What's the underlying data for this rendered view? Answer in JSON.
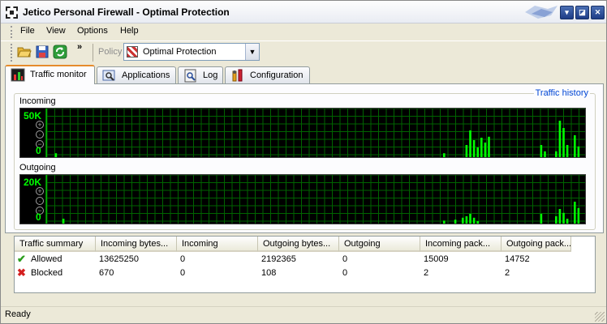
{
  "window": {
    "title": "Jetico Personal Firewall - Optimal Protection"
  },
  "menu": {
    "items": [
      "File",
      "View",
      "Options",
      "Help"
    ]
  },
  "toolbar": {
    "buttons": [
      "open-folder-icon",
      "save-disk-icon",
      "refresh-icon"
    ],
    "overflow": "»",
    "policy_label": "Policy",
    "policy_value": "Optimal Protection"
  },
  "tabs": [
    {
      "label": "Traffic monitor",
      "icon": "traffic-monitor-icon",
      "active": true
    },
    {
      "label": "Applications",
      "icon": "applications-icon",
      "active": false
    },
    {
      "label": "Log",
      "icon": "log-icon",
      "active": false
    },
    {
      "label": "Configuration",
      "icon": "configuration-icon",
      "active": false
    }
  ],
  "traffic_history": {
    "title": "Traffic history",
    "incoming": {
      "label": "Incoming",
      "scale_max": "50K",
      "scale_min": "0",
      "bars": [
        {
          "s": 1,
          "v": 0.08
        },
        {
          "s": 105,
          "v": 0.08
        },
        {
          "s": 111,
          "v": 0.25
        },
        {
          "s": 112,
          "v": 0.55
        },
        {
          "s": 113,
          "v": 0.35
        },
        {
          "s": 114,
          "v": 0.2
        },
        {
          "s": 115,
          "v": 0.4
        },
        {
          "s": 116,
          "v": 0.3
        },
        {
          "s": 117,
          "v": 0.42
        },
        {
          "s": 131,
          "v": 0.25
        },
        {
          "s": 132,
          "v": 0.12
        },
        {
          "s": 135,
          "v": 0.12
        },
        {
          "s": 136,
          "v": 0.75
        },
        {
          "s": 137,
          "v": 0.6
        },
        {
          "s": 138,
          "v": 0.25
        },
        {
          "s": 140,
          "v": 0.45
        },
        {
          "s": 141,
          "v": 0.22
        }
      ]
    },
    "outgoing": {
      "label": "Outgoing",
      "scale_max": "20K",
      "scale_min": "0",
      "bars": [
        {
          "s": 3,
          "v": 0.1
        },
        {
          "s": 105,
          "v": 0.06
        },
        {
          "s": 108,
          "v": 0.08
        },
        {
          "s": 110,
          "v": 0.12
        },
        {
          "s": 111,
          "v": 0.15
        },
        {
          "s": 112,
          "v": 0.2
        },
        {
          "s": 113,
          "v": 0.12
        },
        {
          "s": 114,
          "v": 0.05
        },
        {
          "s": 131,
          "v": 0.2
        },
        {
          "s": 135,
          "v": 0.15
        },
        {
          "s": 136,
          "v": 0.3
        },
        {
          "s": 137,
          "v": 0.22
        },
        {
          "s": 138,
          "v": 0.1
        },
        {
          "s": 140,
          "v": 0.45
        },
        {
          "s": 141,
          "v": 0.32
        }
      ]
    }
  },
  "summary": {
    "columns": [
      "Traffic summary",
      "Incoming bytes...",
      "Incoming",
      "Outgoing bytes...",
      "Outgoing",
      "Incoming pack...",
      "Outgoing pack..."
    ],
    "rows": [
      {
        "status": "allowed",
        "cells": [
          "Allowed",
          "13625250",
          "0",
          "2192365",
          "0",
          "15009",
          "14752"
        ]
      },
      {
        "status": "blocked",
        "cells": [
          "Blocked",
          "670",
          "0",
          "108",
          "0",
          "2",
          "2"
        ]
      }
    ]
  },
  "status": {
    "text": "Ready"
  },
  "colors": {
    "graph_bg": "#000000",
    "graph_grid": "#006400",
    "graph_bar": "#00ff00",
    "allowed": "#2a9d1c",
    "blocked": "#d42020",
    "link": "#0046d5"
  }
}
